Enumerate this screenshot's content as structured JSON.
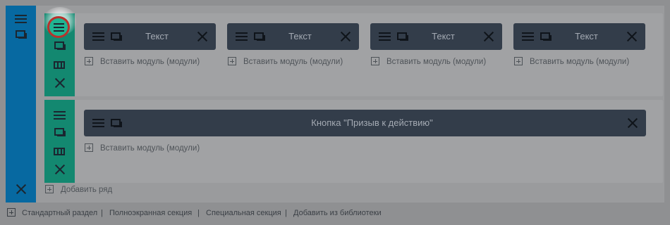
{
  "colors": {
    "section_bar": "#0769a1",
    "row_bar": "#138870",
    "module_bg": "#333d4a",
    "highlight_ring": "#b8322c"
  },
  "section": {
    "icons": [
      "menu-icon",
      "duplicate-icon",
      "close-icon"
    ]
  },
  "rows": [
    {
      "icons": [
        "menu-icon",
        "duplicate-icon",
        "columns-icon",
        "close-icon"
      ],
      "columns": [
        {
          "module_label": "Текст",
          "insert_label": "Вставить модуль (модули)"
        },
        {
          "module_label": "Текст",
          "insert_label": "Вставить модуль (модули)"
        },
        {
          "module_label": "Текст",
          "insert_label": "Вставить модуль (модули)"
        },
        {
          "module_label": "Текст",
          "insert_label": "Вставить модуль (модули)"
        }
      ]
    },
    {
      "icons": [
        "menu-icon",
        "duplicate-icon",
        "columns-icon",
        "close-icon"
      ],
      "columns": [
        {
          "module_label": "Кнопка \"Призыв к действию\"",
          "insert_label": "Вставить модуль (модули)"
        }
      ]
    }
  ],
  "add_row_label": "Добавить ряд",
  "footer": {
    "links": [
      "Стандартный раздел",
      "Полноэкранная секция",
      "Специальная секция",
      "Добавить из библиотеки"
    ],
    "separator": "|"
  }
}
